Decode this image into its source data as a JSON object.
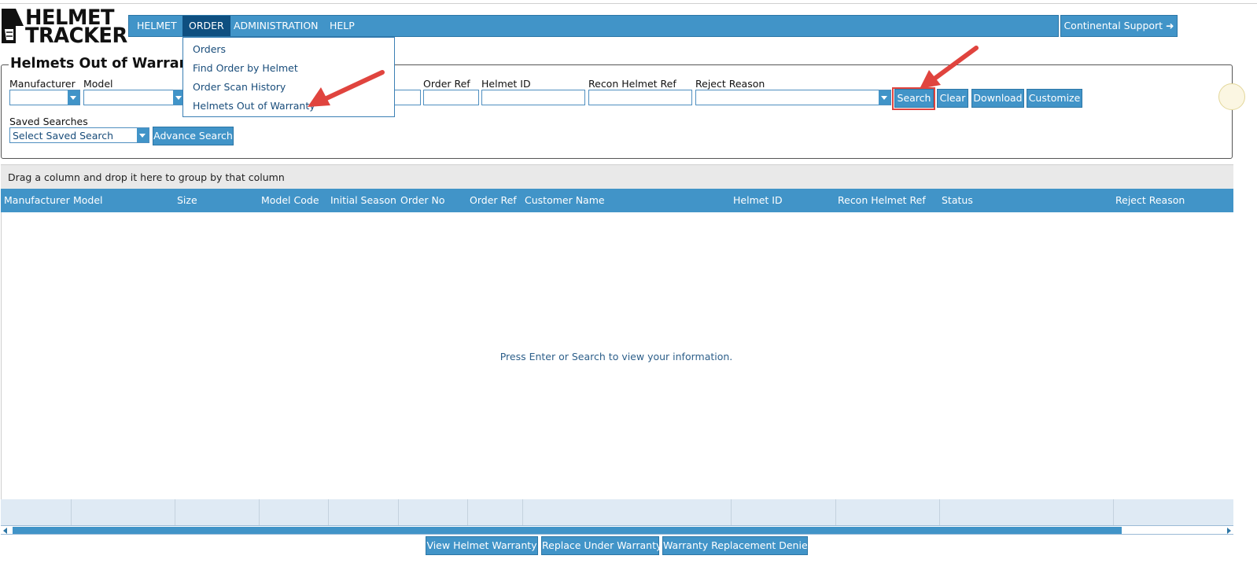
{
  "logo": {
    "line1": "HELMET",
    "line2": "TRACKER"
  },
  "nav": {
    "items": [
      "HELMET",
      "ORDER",
      "ADMINISTRATION",
      "HELP"
    ],
    "active": "ORDER",
    "support_label": "Continental Support ➜"
  },
  "dropdown": {
    "items": [
      "Orders",
      "Find Order by Helmet",
      "Order Scan History",
      "Helmets Out of Warranty"
    ]
  },
  "page": {
    "title": "Helmets Out of Warranty"
  },
  "filters": {
    "manufacturer_label": "Manufacturer",
    "model_label": "Model",
    "order_ref_label": "Order Ref",
    "helmet_id_label": "Helmet ID",
    "recon_helmet_ref_label": "Recon Helmet Ref",
    "reject_reason_label": "Reject Reason",
    "saved_searches_label": "Saved Searches",
    "saved_search_value": "Select Saved Search",
    "buttons": {
      "search": "Search",
      "clear": "Clear",
      "download": "Download",
      "customize": "Customize",
      "advance_search": "Advance Search"
    }
  },
  "grid": {
    "group_hint": "Drag a column and drop it here to group by that column",
    "columns": [
      "Manufacturer",
      "Model",
      "Size",
      "Model Code",
      "Initial Season",
      "Order No",
      "Order Ref",
      "Customer Name",
      "Helmet ID",
      "Recon Helmet Ref",
      "Status",
      "Reject Reason"
    ],
    "empty_message": "Press Enter or Search to view your information."
  },
  "actions": {
    "view_helmet_warranty": "View Helmet Warranty",
    "replace_under_warranty": "Replace Under Warranty",
    "warranty_replacement_denied": "Warranty Replacement Denied"
  },
  "colors": {
    "primary": "#4194c8",
    "active_nav": "#0e4f80",
    "annotation_red": "#e0443e"
  }
}
